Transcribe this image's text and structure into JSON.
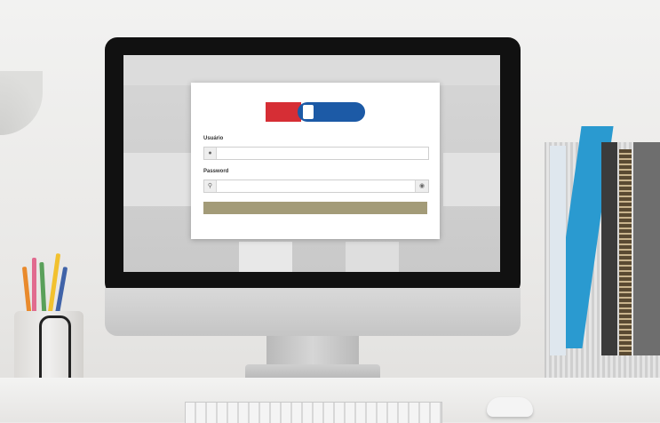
{
  "scene": {
    "description_colors": {
      "wall": "#eeeeed",
      "monitor_bezel": "#111111",
      "button": "#a39b78",
      "logo_red": "#d62e35",
      "logo_blue": "#1c5aa6"
    }
  },
  "login": {
    "logo_left_text": "",
    "logo_right_text": "",
    "user_label": "Usuário",
    "user_placeholder": "",
    "password_label": "Password",
    "password_placeholder": "",
    "submit_label": "",
    "forgot_link": "",
    "icons": {
      "user": "user-icon",
      "password": "key-icon",
      "toggle": "eye-icon"
    }
  }
}
